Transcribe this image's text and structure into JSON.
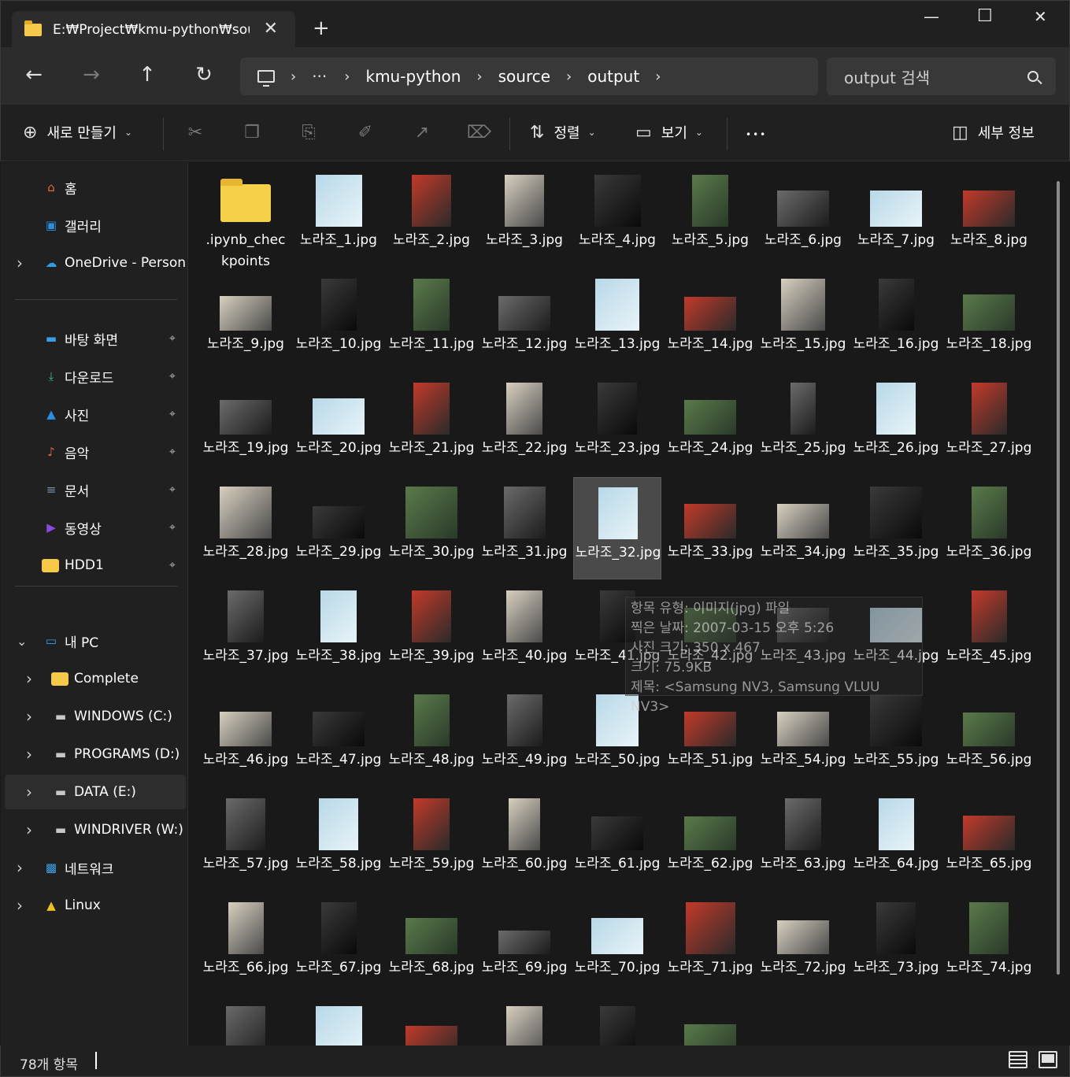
{
  "window": {
    "tab_title": "E:₩Project₩kmu-python₩sou",
    "close_tab_glyph": "✕",
    "new_tab_glyph": "+",
    "minimize_glyph": "—",
    "maximize_glyph": "☐",
    "close_glyph": "✕"
  },
  "nav": {
    "back_glyph": "←",
    "forward_glyph": "→",
    "up_glyph": "↑",
    "refresh_glyph": "↻",
    "more_crumbs": "···",
    "separator": "›",
    "breadcrumbs": [
      "kmu-python",
      "source",
      "output"
    ],
    "search_placeholder": "output 검색"
  },
  "toolbar": {
    "new_label": "새로 만들기",
    "sort_label": "정렬",
    "view_label": "보기",
    "more_glyph": "•••",
    "details_label": "세부 정보",
    "icons": {
      "new": "⊕",
      "cut": "✂",
      "copy": "❐",
      "paste": "⎘",
      "rename": "✐",
      "share": "↗",
      "delete": "⌦",
      "sort": "⇅",
      "view": "▭",
      "details": "◫",
      "chevron": "⌄"
    }
  },
  "sidebar": {
    "items": [
      {
        "label": "홈",
        "icon": "home-icon",
        "glyph": "⌂",
        "color": "#e8693c",
        "expandable": false,
        "pinned": false
      },
      {
        "label": "갤러리",
        "icon": "gallery-icon",
        "glyph": "▣",
        "color": "#2b8fe0",
        "expandable": false,
        "pinned": false
      },
      {
        "label": "OneDrive - Personal",
        "icon": "cloud-icon",
        "glyph": "☁",
        "color": "#2e9be8",
        "expandable": true,
        "pinned": false
      },
      {
        "label": "바탕 화면",
        "icon": "desktop-icon",
        "glyph": "▬",
        "color": "#3aa0e8",
        "expandable": false,
        "pinned": true
      },
      {
        "label": "다운로드",
        "icon": "download-icon",
        "glyph": "⤓",
        "color": "#3bb87a",
        "expandable": false,
        "pinned": true
      },
      {
        "label": "사진",
        "icon": "pictures-icon",
        "glyph": "▲",
        "color": "#2b8fe0",
        "expandable": false,
        "pinned": true
      },
      {
        "label": "음악",
        "icon": "music-icon",
        "glyph": "♪",
        "color": "#e0604c",
        "expandable": false,
        "pinned": true
      },
      {
        "label": "문서",
        "icon": "documents-icon",
        "glyph": "≡",
        "color": "#7a8fa8",
        "expandable": false,
        "pinned": true
      },
      {
        "label": "동영상",
        "icon": "videos-icon",
        "glyph": "▶",
        "color": "#8a4be0",
        "expandable": false,
        "pinned": true
      },
      {
        "label": "HDD1",
        "icon": "folder-icon",
        "glyph": "",
        "color": "#f7c948",
        "expandable": false,
        "pinned": true
      },
      {
        "label": "내 PC",
        "icon": "pc-icon",
        "glyph": "▭",
        "color": "#3aa0e8",
        "expandable": true,
        "expanded": true,
        "pinned": false
      },
      {
        "label": "Complete",
        "icon": "folder-icon",
        "glyph": "",
        "color": "#f7c948",
        "expandable": true,
        "pinned": false
      },
      {
        "label": "WINDOWS (C:)",
        "icon": "drive-icon",
        "glyph": "▬",
        "color": "#c8c8c8",
        "expandable": true,
        "pinned": false
      },
      {
        "label": "PROGRAMS (D:)",
        "icon": "drive-icon",
        "glyph": "▬",
        "color": "#c8c8c8",
        "expandable": true,
        "pinned": false
      },
      {
        "label": "DATA (E:)",
        "icon": "drive-icon",
        "glyph": "▬",
        "color": "#c8c8c8",
        "expandable": true,
        "pinned": false,
        "selected": true
      },
      {
        "label": "WINDRIVER (W:)",
        "icon": "drive-icon",
        "glyph": "▬",
        "color": "#c8c8c8",
        "expandable": true,
        "pinned": false
      },
      {
        "label": "네트워크",
        "icon": "network-icon",
        "glyph": "▩",
        "color": "#3aa0e8",
        "expandable": true,
        "pinned": false
      },
      {
        "label": "Linux",
        "icon": "linux-icon",
        "glyph": "▲",
        "color": "#f0c020",
        "expandable": true,
        "pinned": false
      }
    ],
    "pin_glyph": "⌖",
    "expand_glyph": "›",
    "collapse_glyph": "⌄"
  },
  "files": [
    {
      "name": ".ipynb_checkpoints",
      "folder": true
    },
    {
      "name": "노라조_1.jpg",
      "aspect": 0.9
    },
    {
      "name": "노라조_2.jpg",
      "aspect": 0.75
    },
    {
      "name": "노라조_3.jpg",
      "aspect": 0.75
    },
    {
      "name": "노라조_4.jpg",
      "aspect": 0.9
    },
    {
      "name": "노라조_5.jpg",
      "aspect": 0.7
    },
    {
      "name": "노라조_6.jpg",
      "aspect": 1.45
    },
    {
      "name": "노라조_7.jpg",
      "aspect": 1.45
    },
    {
      "name": "노라조_8.jpg",
      "aspect": 1.45
    },
    {
      "name": "노라조_9.jpg",
      "aspect": 1.5
    },
    {
      "name": "노라조_10.jpg",
      "aspect": 0.68
    },
    {
      "name": "노라조_11.jpg",
      "aspect": 0.7
    },
    {
      "name": "노라조_12.jpg",
      "aspect": 1.5
    },
    {
      "name": "노라조_13.jpg",
      "aspect": 0.85
    },
    {
      "name": "노라조_14.jpg",
      "aspect": 1.55
    },
    {
      "name": "노라조_15.jpg",
      "aspect": 0.85
    },
    {
      "name": "노라조_16.jpg",
      "aspect": 0.68
    },
    {
      "name": "노라조_18.jpg",
      "aspect": 1.45
    },
    {
      "name": "노라조_19.jpg",
      "aspect": 1.5
    },
    {
      "name": "노라조_20.jpg",
      "aspect": 1.45
    },
    {
      "name": "노라조_21.jpg",
      "aspect": 0.7
    },
    {
      "name": "노라조_22.jpg",
      "aspect": 0.7
    },
    {
      "name": "노라조_23.jpg",
      "aspect": 0.75
    },
    {
      "name": "노라조_24.jpg",
      "aspect": 1.5
    },
    {
      "name": "노라조_25.jpg",
      "aspect": 0.48
    },
    {
      "name": "노라조_26.jpg",
      "aspect": 0.75
    },
    {
      "name": "노라조_27.jpg",
      "aspect": 0.68
    },
    {
      "name": "노라조_28.jpg",
      "aspect": 1.0
    },
    {
      "name": "노라조_29.jpg",
      "aspect": 1.6
    },
    {
      "name": "노라조_30.jpg",
      "aspect": 1.0
    },
    {
      "name": "노라조_31.jpg",
      "aspect": 0.8
    },
    {
      "name": "노라조_32.jpg",
      "aspect": 0.75,
      "selected": true
    },
    {
      "name": "노라조_33.jpg",
      "aspect": 1.5
    },
    {
      "name": "노라조_34.jpg",
      "aspect": 1.5
    },
    {
      "name": "노라조_35.jpg",
      "aspect": 1.0
    },
    {
      "name": "노라조_36.jpg",
      "aspect": 0.68
    },
    {
      "name": "노라조_37.jpg",
      "aspect": 0.7
    },
    {
      "name": "노라조_38.jpg",
      "aspect": 0.7
    },
    {
      "name": "노라조_39.jpg",
      "aspect": 0.75
    },
    {
      "name": "노라조_40.jpg",
      "aspect": 0.7
    },
    {
      "name": "노라조_41.jpg",
      "aspect": 0.68
    },
    {
      "name": "노라조_42.jpg",
      "aspect": 1.5
    },
    {
      "name": "노라조_43.jpg",
      "aspect": 1.5
    },
    {
      "name": "노라조_44.jpg",
      "aspect": 1.5
    },
    {
      "name": "노라조_45.jpg",
      "aspect": 0.68
    },
    {
      "name": "노라조_46.jpg",
      "aspect": 1.5
    },
    {
      "name": "노라조_47.jpg",
      "aspect": 1.5
    },
    {
      "name": "노라조_48.jpg",
      "aspect": 0.68
    },
    {
      "name": "노라조_49.jpg",
      "aspect": 0.68
    },
    {
      "name": "노라조_50.jpg",
      "aspect": 0.82
    },
    {
      "name": "노라조_51.jpg",
      "aspect": 1.5
    },
    {
      "name": "노라조_54.jpg",
      "aspect": 1.5
    },
    {
      "name": "노라조_55.jpg",
      "aspect": 1.0
    },
    {
      "name": "노라조_56.jpg",
      "aspect": 1.55
    },
    {
      "name": "노라조_57.jpg",
      "aspect": 0.75
    },
    {
      "name": "노라조_58.jpg",
      "aspect": 0.75
    },
    {
      "name": "노라조_59.jpg",
      "aspect": 0.7
    },
    {
      "name": "노라조_60.jpg",
      "aspect": 0.6
    },
    {
      "name": "노라조_61.jpg",
      "aspect": 1.55
    },
    {
      "name": "노라조_62.jpg",
      "aspect": 1.55
    },
    {
      "name": "노라조_63.jpg",
      "aspect": 0.7
    },
    {
      "name": "노라조_64.jpg",
      "aspect": 0.68
    },
    {
      "name": "노라조_65.jpg",
      "aspect": 1.5
    },
    {
      "name": "노라조_66.jpg",
      "aspect": 0.68
    },
    {
      "name": "노라조_67.jpg",
      "aspect": 0.68
    },
    {
      "name": "노라조_68.jpg",
      "aspect": 1.45
    },
    {
      "name": "노라조_69.jpg",
      "aspect": 2.2
    },
    {
      "name": "노라조_70.jpg",
      "aspect": 1.45
    },
    {
      "name": "노라조_71.jpg",
      "aspect": 0.95
    },
    {
      "name": "노라조_72.jpg",
      "aspect": 1.55
    },
    {
      "name": "노라조_73.jpg",
      "aspect": 0.75
    },
    {
      "name": "노라조_74.jpg",
      "aspect": 0.75
    },
    {
      "name": "",
      "aspect": 0.75
    },
    {
      "name": "",
      "aspect": 0.9
    },
    {
      "name": "",
      "aspect": 1.6
    },
    {
      "name": "",
      "aspect": 0.7
    },
    {
      "name": "",
      "aspect": 0.68
    },
    {
      "name": "",
      "aspect": 1.55
    }
  ],
  "tooltip": [
    "항목 유형: 이미지(jpg) 파일",
    "찍은 날짜: 2007-03-15 오후 5:26",
    "사진 크기: 350 x 467",
    "크기: 75.9KB",
    "제목: <Samsung NV3, Samsung VLUU NV3>"
  ],
  "status": {
    "item_count": "78개 항목"
  },
  "colors": {
    "accent_folder": "#f7d04a",
    "background": "#191919",
    "panel": "#202020"
  }
}
